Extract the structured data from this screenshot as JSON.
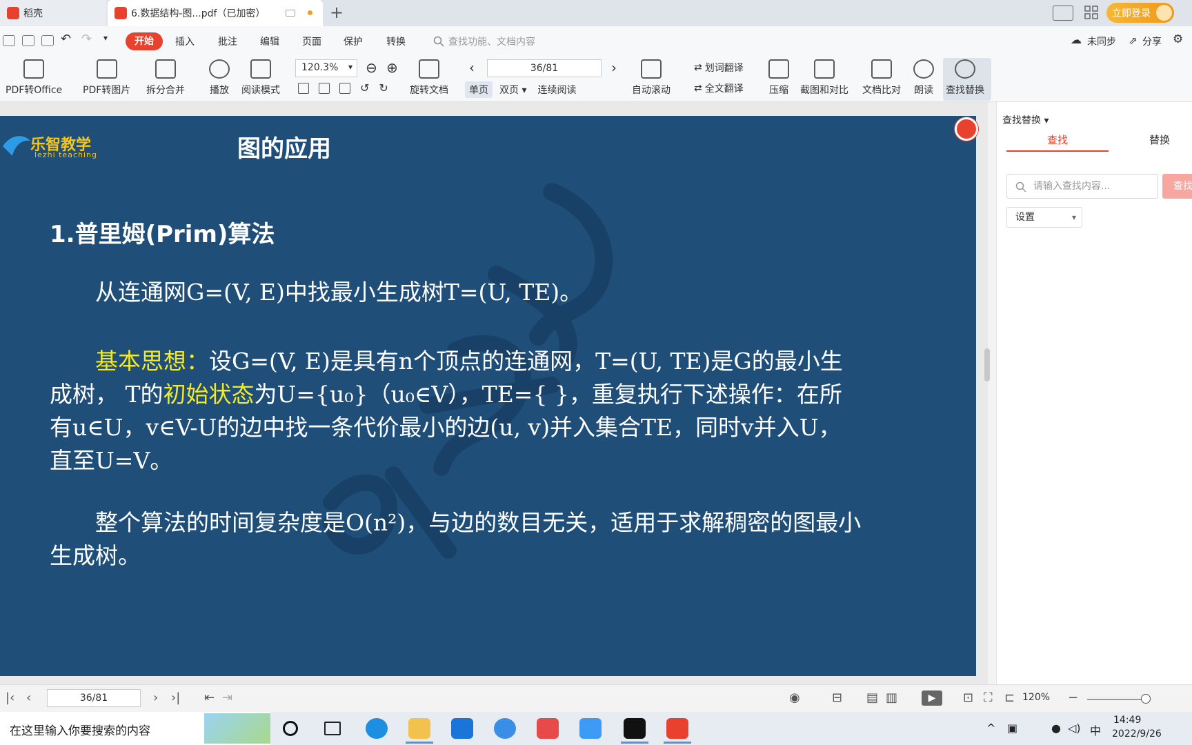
{
  "tabs": {
    "home_label": "稻壳",
    "doc_label": "6.数据结构-图...pdf（已加密）",
    "add_label": "+"
  },
  "account": {
    "login_label": "立即登录"
  },
  "menu": {
    "start": "开始",
    "items": [
      "插入",
      "批注",
      "编辑",
      "页面",
      "保护",
      "转换"
    ],
    "search_placeholder": "查找功能、文档内容",
    "sync_label": "未同步",
    "share_label": "分享"
  },
  "ribbon": {
    "pdf_to_office": "PDF转Office",
    "pdf_to_image": "PDF转图片",
    "split_merge": "拆分合并",
    "play": "播放",
    "reading_mode": "阅读模式",
    "zoom_value": "120.3%",
    "rotate_doc": "旋转文档",
    "page_value": "36/81",
    "single_page": "单页",
    "double_page": "双页",
    "continuous": "连续阅读",
    "auto_scroll": "自动滚动",
    "word_translate": "划词翻译",
    "full_translate": "全文翻译",
    "compress": "压缩",
    "screenshot_compare": "截图和对比",
    "doc_compare": "文档比对",
    "read_aloud": "朗读",
    "find_replace": "查找替换"
  },
  "slide": {
    "logo_text": "乐智教学",
    "logo_sub": "lezhi teaching",
    "title": "图的应用",
    "heading": "1.普里姆(Prim)算法",
    "para1": "从连通网G=(V, E)中找最小生成树T=(U, TE)。",
    "para2_label": "基本思想：",
    "para2_a": "设G=(V, E)是具有n个顶点的连通网，T=(U, TE)是G的最小生成树， T的",
    "para2_highlight": "初始状态",
    "para2_b": "为U={u₀}（u₀∈V），TE={ }，重复执行下述操作：在所有u∈U，v∈V-U的边中找一条代价最小的边(u, v)并入集合TE，同时v并入U，直至U=V。",
    "para3": "整个算法的时间复杂度是O(n²)，与边的数目无关，适用于求解稠密的图最小生成树。"
  },
  "panel": {
    "title": "查找替换",
    "tab_find": "查找",
    "tab_replace": "替换",
    "find_placeholder": "请输入查找内容...",
    "find_button": "查找",
    "settings_label": "设置"
  },
  "status": {
    "page_value": "36/81",
    "zoom_value": "120%"
  },
  "taskbar": {
    "search_placeholder": "在这里输入你要搜索的内容",
    "ime": "中",
    "time": "14:49",
    "date": "2022/9/26"
  }
}
